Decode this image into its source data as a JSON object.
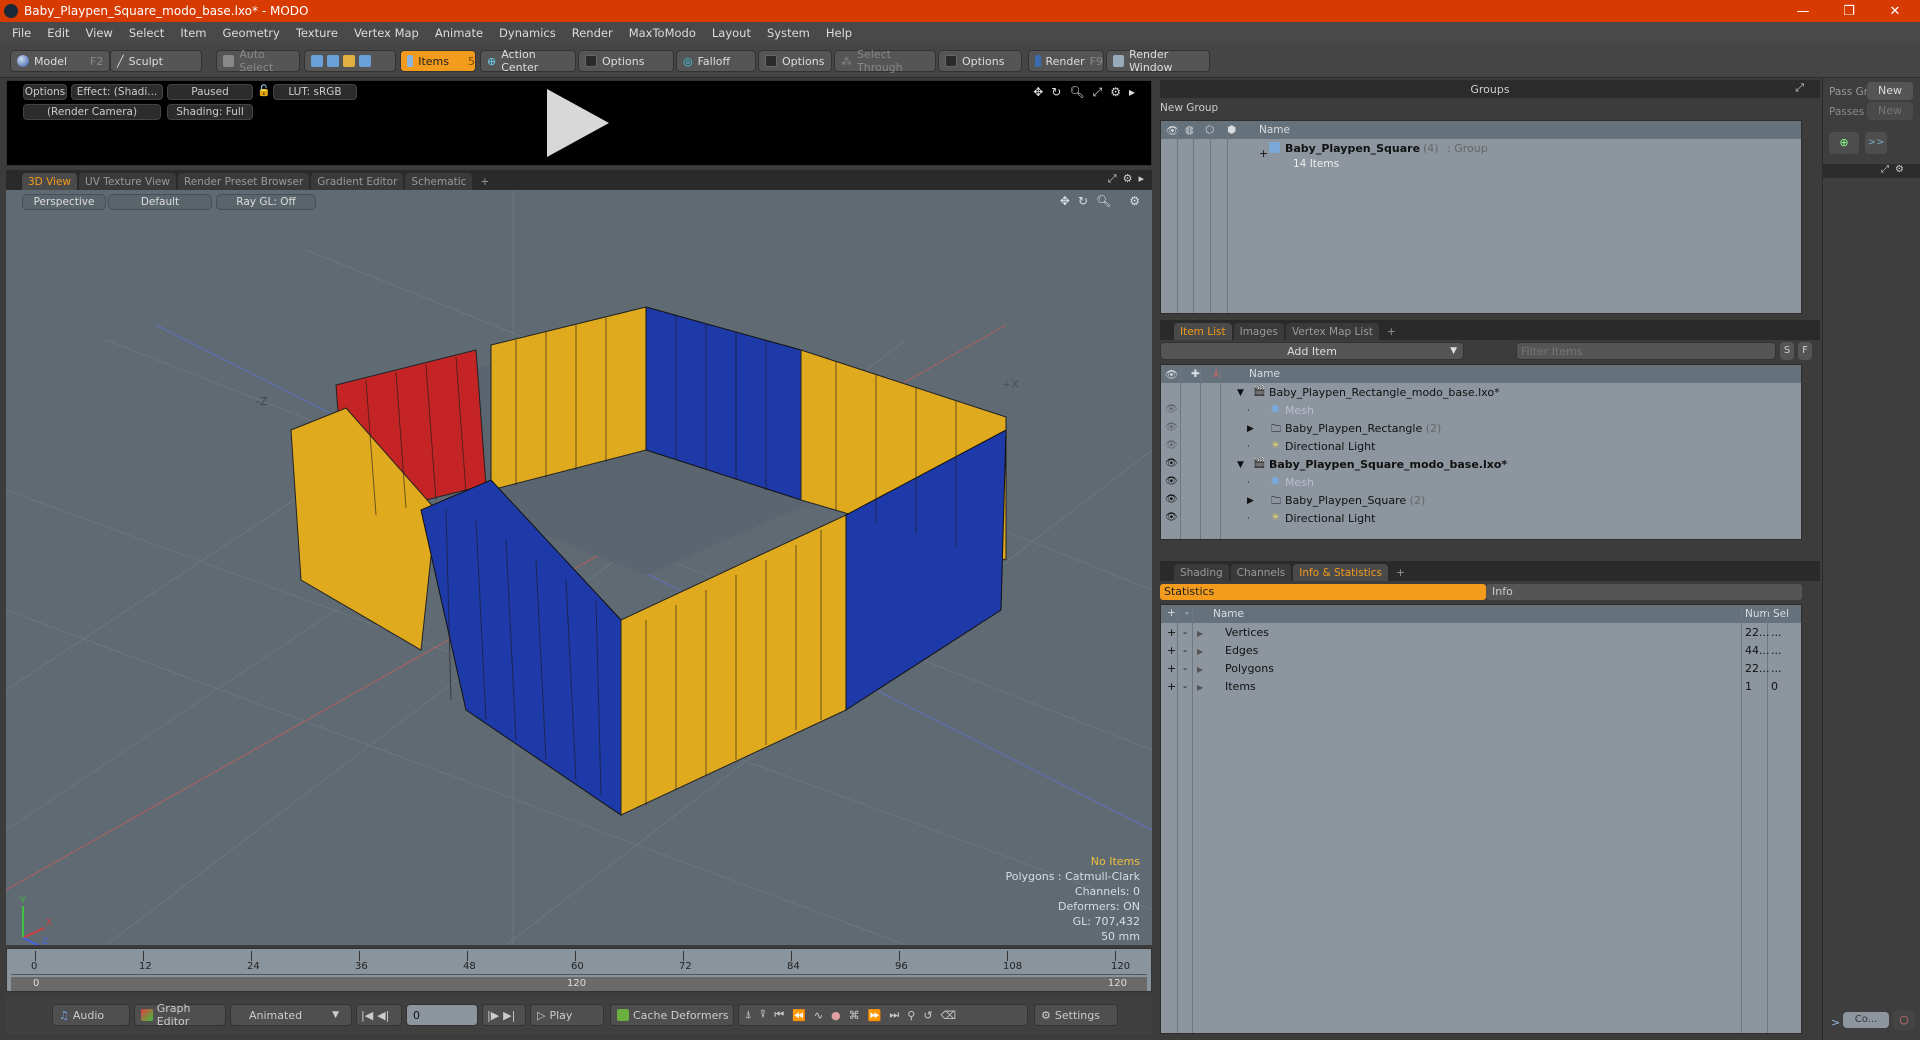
{
  "window": {
    "title": "Baby_Playpen_Square_modo_base.lxo* - MODO",
    "controls": {
      "minimize": "—",
      "restore": "❐",
      "close": "✕"
    }
  },
  "menu": [
    "File",
    "Edit",
    "View",
    "Select",
    "Item",
    "Geometry",
    "Texture",
    "Vertex Map",
    "Animate",
    "Dynamics",
    "Render",
    "MaxToModo",
    "Layout",
    "System",
    "Help"
  ],
  "toolbar": {
    "model": "Model",
    "model_key": "F2",
    "sculpt": "Sculpt",
    "auto_select": "Auto Select",
    "items": "Items",
    "items_key": "5",
    "action_center": "Action Center",
    "options1": "Options",
    "falloff": "Falloff",
    "options2": "Options",
    "select_through": "Select Through",
    "options3": "Options",
    "render": "Render",
    "render_key": "F9",
    "render_window": "Render Window"
  },
  "preview": {
    "options": "Options",
    "effect": "Effect: (Shadi...",
    "paused": "Paused",
    "lut": "LUT: sRGB",
    "camera": "(Render Camera)",
    "shading": "Shading: Full"
  },
  "viewport_tabs": [
    "3D View",
    "UV Texture View",
    "Render Preset Browser",
    "Gradient Editor",
    "Schematic",
    "+"
  ],
  "viewport": {
    "perspective": "Perspective",
    "default": "Default",
    "raygl": "Ray GL: Off",
    "axis_minus_z": "-Z",
    "axis_plus_x": "+X",
    "info": {
      "selection": "No Items",
      "polygons": "Polygons : Catmull-Clark",
      "channels": "Channels: 0",
      "deformers": "Deformers: ON",
      "gl": "GL: 707,432",
      "lens": "50 mm"
    },
    "gizmo": {
      "x": "X",
      "y": "Y",
      "z": "Z"
    }
  },
  "timeline": {
    "ticks": [
      "0",
      "12",
      "24",
      "36",
      "48",
      "60",
      "72",
      "84",
      "96",
      "108",
      "120"
    ],
    "range_start": "0",
    "range_mid": "120",
    "range_end": "120"
  },
  "bottombar": {
    "audio": "Audio",
    "graph_editor": "Graph Editor",
    "animated": "Animated",
    "frame": "0",
    "play": "Play",
    "cache_deformers": "Cache Deformers",
    "settings": "Settings"
  },
  "groups": {
    "title": "Groups",
    "new_group": "New Group",
    "name_header": "Name",
    "row": {
      "name": "Baby_Playpen_Square",
      "count": "(4)",
      "type": ": Group",
      "sub": "14 Items"
    }
  },
  "passes": {
    "pass_groups": "Pass Gro",
    "new1": "New",
    "passes": "Passes",
    "new2": "New",
    "more": ">>"
  },
  "itemlist": {
    "tabs": [
      "Item List",
      "Images",
      "Vertex Map List",
      "+"
    ],
    "add_item": "Add Item",
    "filter_placeholder": "Filter Items",
    "s": "S",
    "f": "F",
    "name_header": "Name",
    "rows": [
      {
        "label": "Baby_Playpen_Rectangle_modo_base.lxo*",
        "bold": false,
        "indent": 0,
        "dim": false
      },
      {
        "label": "Mesh",
        "bold": false,
        "indent": 1,
        "dim": true
      },
      {
        "label": "Baby_Playpen_Rectangle",
        "count": "(2)",
        "bold": false,
        "indent": 1,
        "dim": false
      },
      {
        "label": "Directional Light",
        "bold": false,
        "indent": 1,
        "dim": false
      },
      {
        "label": "Baby_Playpen_Square_modo_base.lxo*",
        "bold": true,
        "indent": 0,
        "dim": false
      },
      {
        "label": "Mesh",
        "bold": false,
        "indent": 1,
        "dim": true
      },
      {
        "label": "Baby_Playpen_Square",
        "count": "(2)",
        "bold": false,
        "indent": 1,
        "dim": false
      },
      {
        "label": "Directional Light",
        "bold": false,
        "indent": 1,
        "dim": false
      }
    ]
  },
  "stats": {
    "tabs": [
      "Shading",
      "Channels",
      "Info & Statistics",
      "+"
    ],
    "statistics": "Statistics",
    "info": "Info",
    "headers": {
      "name": "Name",
      "num": "Num",
      "sel": "Sel"
    },
    "rows": [
      {
        "name": "Vertices",
        "num": "22...",
        "sel": "..."
      },
      {
        "name": "Edges",
        "num": "44...",
        "sel": "..."
      },
      {
        "name": "Polygons",
        "num": "22...",
        "sel": "..."
      },
      {
        "name": "Items",
        "num": "1",
        "sel": "0"
      }
    ]
  },
  "corner": {
    "command": "Co..."
  },
  "colors": {
    "accent": "#f29b1c",
    "titlebar": "#d83b01",
    "blue": "#1e3aa8",
    "yellow": "#e0aa1e",
    "red": "#c42424"
  }
}
